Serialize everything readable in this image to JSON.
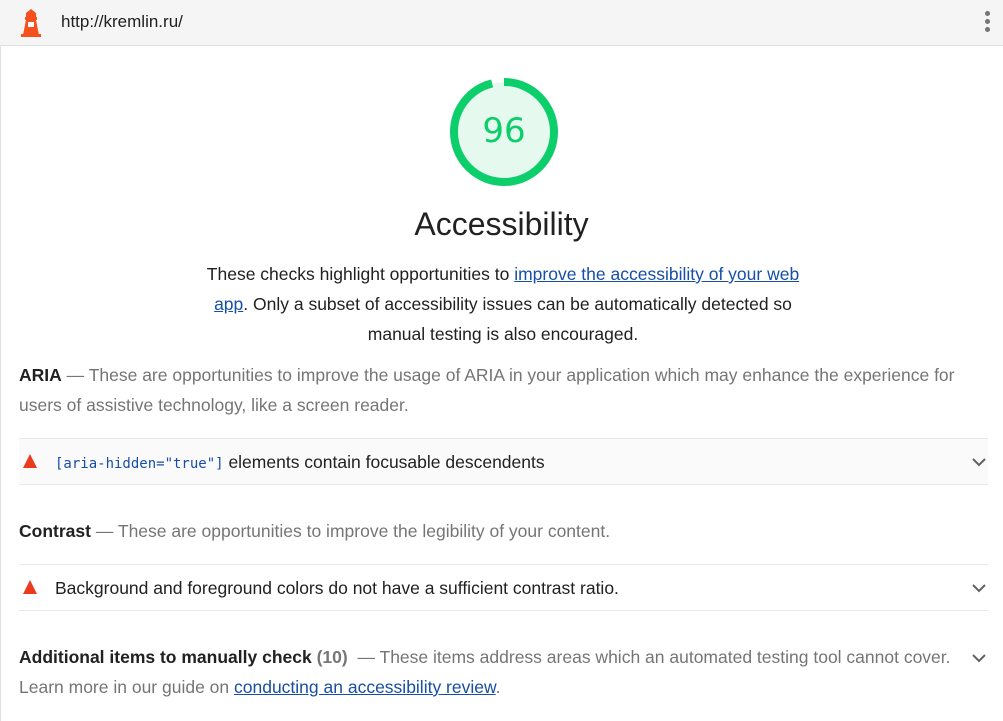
{
  "header": {
    "url": "http://kremlin.ru/",
    "logo_icon": "lighthouse-icon",
    "menu_icon": "kebab-menu-icon"
  },
  "score": {
    "value": "96",
    "gauge_fraction": 0.96,
    "color": "#0cce6b"
  },
  "category": {
    "title": "Accessibility",
    "description_before": "These checks highlight opportunities to ",
    "description_link": "improve the accessibility of your web app",
    "description_after": ". Only a subset of accessibility issues can be automatically detected so manual testing is also encouraged."
  },
  "groups": {
    "aria": {
      "title": "ARIA",
      "separator": "—",
      "description": "These are opportunities to improve the usage of ARIA in your application which may enhance the experience for users of assistive technology, like a screen reader.",
      "audits": [
        {
          "code": "[aria-hidden=\"true\"]",
          "title": " elements contain focusable descendents",
          "status": "fail"
        }
      ]
    },
    "contrast": {
      "title": "Contrast",
      "separator": "—",
      "description": "These are opportunities to improve the legibility of your content.",
      "audits": [
        {
          "title": "Background and foreground colors do not have a sufficient contrast ratio.",
          "status": "fail"
        }
      ]
    },
    "manual": {
      "title": "Additional items to manually check",
      "count": "(10)",
      "separator": "—",
      "description_before": "These items address areas which an automated testing tool cannot cover. Learn more in our guide on ",
      "description_link": "conducting an accessibility review",
      "description_after": "."
    }
  },
  "colors": {
    "pass": "#0cce6b",
    "fail": "#eb3b1e",
    "link": "#174ea6"
  }
}
